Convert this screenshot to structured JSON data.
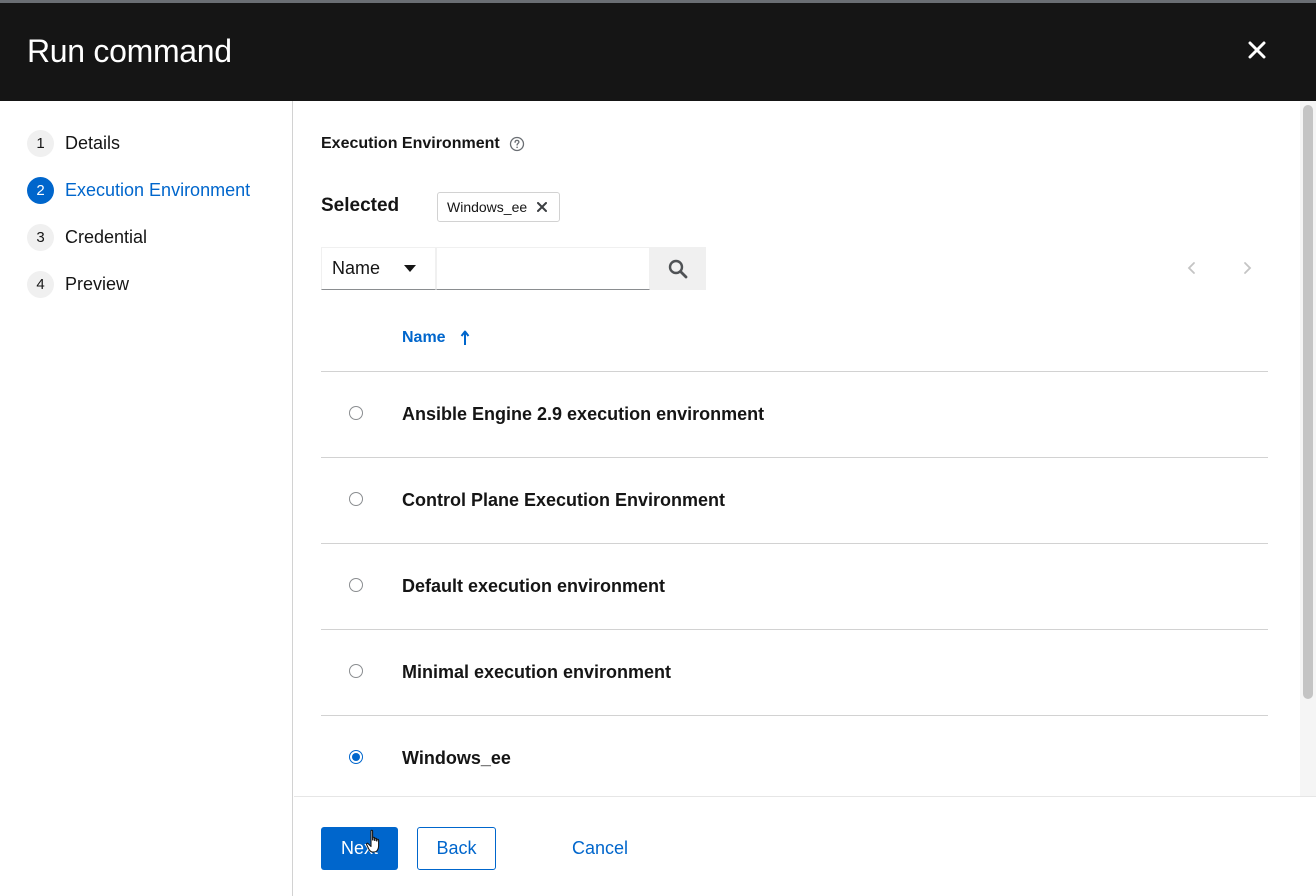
{
  "modal": {
    "title": "Run command",
    "close_icon": "close-icon"
  },
  "wizard_nav": {
    "steps": [
      {
        "number": "1",
        "label": "Details",
        "current": false
      },
      {
        "number": "2",
        "label": "Execution Environment",
        "current": true
      },
      {
        "number": "3",
        "label": "Credential",
        "current": false
      },
      {
        "number": "4",
        "label": "Preview",
        "current": false
      }
    ]
  },
  "main": {
    "field_label": "Execution Environment",
    "help_icon": "question-circle-icon",
    "selected": {
      "label": "Selected",
      "chip_text": "Windows_ee",
      "chip_remove_icon": "close-icon"
    },
    "toolbar": {
      "filter_field": "Name",
      "search_value": "",
      "search_placeholder": "",
      "search_icon": "search-icon",
      "prev_icon": "chevron-left-icon",
      "next_icon": "chevron-right-icon"
    },
    "table": {
      "column_name": "Name",
      "sort_icon": "sort-ascending-icon",
      "rows": [
        {
          "name": "Ansible Engine 2.9 execution environment",
          "selected": false
        },
        {
          "name": "Control Plane Execution Environment",
          "selected": false
        },
        {
          "name": "Default execution environment",
          "selected": false
        },
        {
          "name": "Minimal execution environment",
          "selected": false
        },
        {
          "name": "Windows_ee",
          "selected": true
        }
      ]
    }
  },
  "footer": {
    "next_label": "Next",
    "back_label": "Back",
    "cancel_label": "Cancel"
  },
  "colors": {
    "header_bg": "#151515",
    "accent": "#0066cc",
    "border": "#d2d2d2"
  }
}
